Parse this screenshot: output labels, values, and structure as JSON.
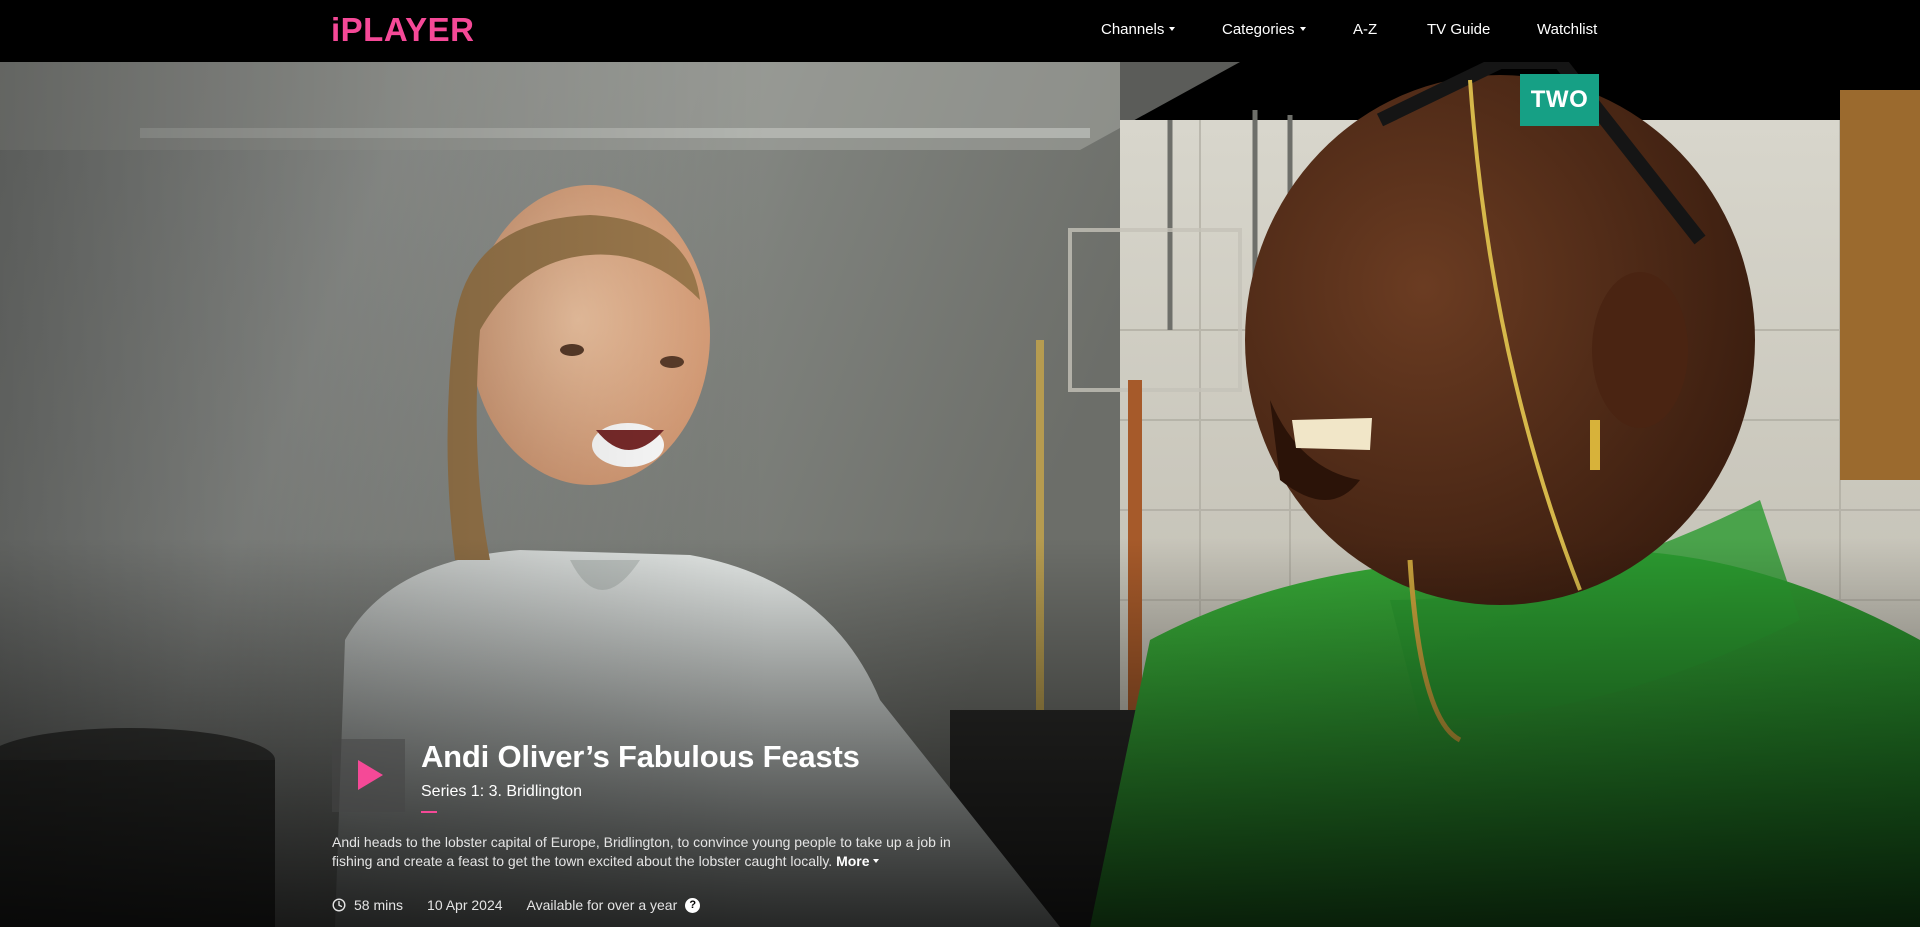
{
  "brand": {
    "logo_text": "iPLAYER",
    "accent_color": "#f54997"
  },
  "nav": {
    "items": [
      {
        "label": "Channels",
        "has_dropdown": true
      },
      {
        "label": "Categories",
        "has_dropdown": true
      },
      {
        "label": "A-Z",
        "has_dropdown": false
      },
      {
        "label": "TV Guide",
        "has_dropdown": false
      },
      {
        "label": "Watchlist",
        "has_dropdown": false
      }
    ]
  },
  "hero": {
    "channel_badge": "TWO",
    "channel_badge_color": "#16a085"
  },
  "programme": {
    "title": "Andi Oliver’s Fabulous Feasts",
    "subtitle": "Series 1: 3. Bridlington",
    "synopsis": "Andi heads to the lobster capital of Europe, Bridlington, to convince young people to take up a job in fishing and create a feast to get the town excited about the lobster caught locally.",
    "more_label": "More",
    "duration": "58 mins",
    "date": "10 Apr 2024",
    "availability": "Available for over a year",
    "help_glyph": "?",
    "play_icon": "play-icon",
    "clock_icon": "clock-icon"
  }
}
